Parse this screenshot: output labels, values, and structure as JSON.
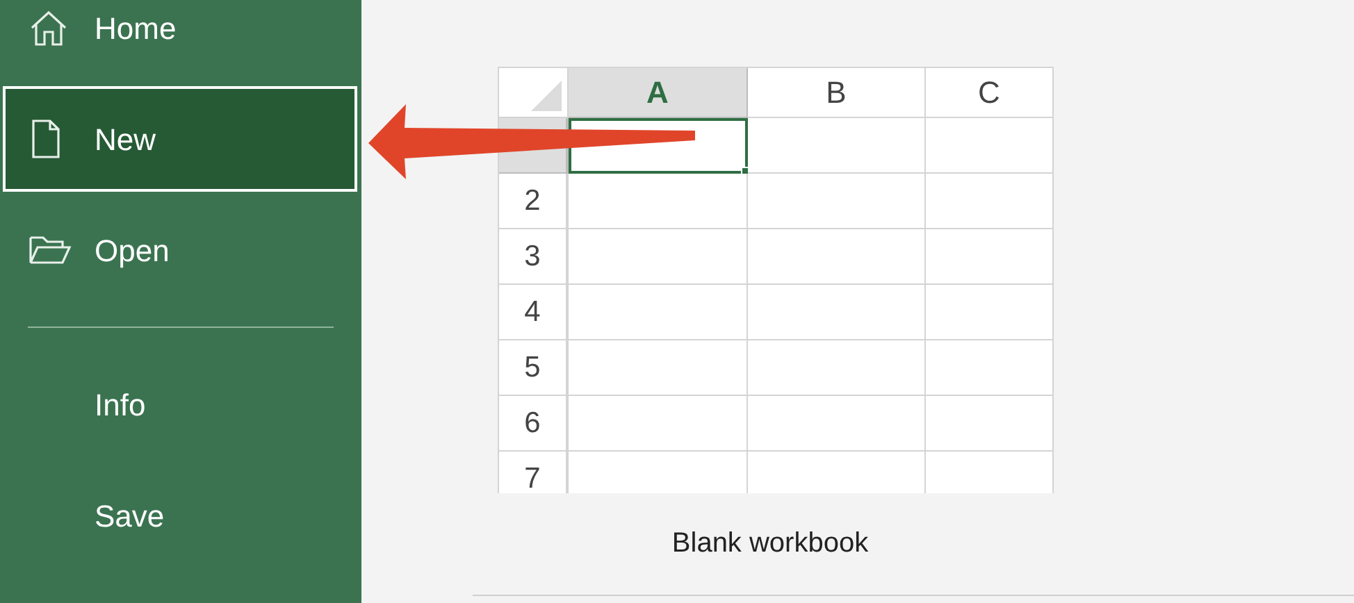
{
  "sidebar": {
    "items": [
      {
        "kind": "icon",
        "label": "Home",
        "selected": false
      },
      {
        "kind": "icon",
        "label": "New",
        "selected": true
      },
      {
        "kind": "icon",
        "label": "Open",
        "selected": false
      },
      {
        "kind": "divider"
      },
      {
        "kind": "text",
        "label": "Info",
        "selected": false
      },
      {
        "kind": "text",
        "label": "Save",
        "selected": false
      }
    ]
  },
  "template": {
    "sheet": {
      "columns": [
        {
          "label": "A",
          "selected": true
        },
        {
          "label": "B",
          "selected": false
        },
        {
          "label": "C",
          "selected": false
        }
      ],
      "rows": [
        {
          "selected": true
        },
        {
          "label": "2",
          "selected": false
        },
        {
          "label": "3",
          "selected": false
        },
        {
          "label": "4",
          "selected": false
        },
        {
          "label": "5",
          "selected": false
        },
        {
          "label": "6",
          "selected": false
        },
        {
          "label": "7",
          "selected": false
        }
      ]
    },
    "caption": "Blank workbook"
  }
}
